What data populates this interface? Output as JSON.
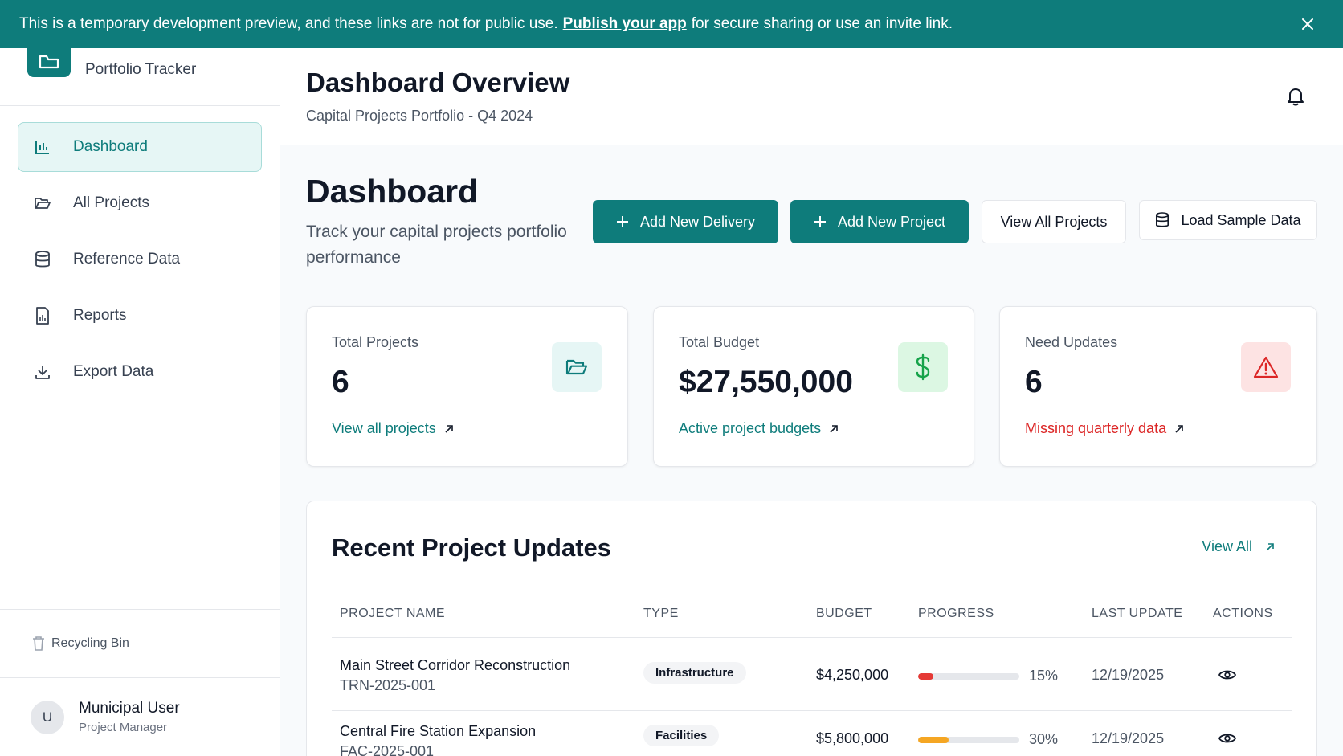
{
  "banner": {
    "text_before": "This is a temporary development preview, and these links are not for public use.",
    "link": "Publish your app",
    "text_after": "for secure sharing or use an invite link."
  },
  "sidebar": {
    "brand": "Portfolio Tracker",
    "items": [
      {
        "label": "Dashboard",
        "icon": "bar-chart-icon",
        "active": true
      },
      {
        "label": "All Projects",
        "icon": "folder-icon"
      },
      {
        "label": "Reference Data",
        "icon": "database-icon"
      },
      {
        "label": "Reports",
        "icon": "report-icon"
      },
      {
        "label": "Export Data",
        "icon": "download-icon"
      }
    ],
    "recycle_label": "Recycling Bin",
    "user": {
      "initial": "U",
      "name": "Municipal User",
      "role": "Project Manager"
    }
  },
  "header": {
    "title": "Dashboard Overview",
    "subtitle": "Capital Projects Portfolio - Q4 2024"
  },
  "main": {
    "title": "Dashboard",
    "description": "Track your capital projects portfolio performance",
    "buttons": {
      "add_delivery": "Add New Delivery",
      "add_project": "Add New Project",
      "view_all": "View All Projects",
      "load_sample": "Load Sample Data"
    },
    "cards": [
      {
        "label": "Total Projects",
        "value": "6",
        "link": "View all projects",
        "accent": "#0e7c7b"
      },
      {
        "label": "Total Budget",
        "value": "$27,550,000",
        "link": "Active project budgets",
        "accent": "#0e7c7b"
      },
      {
        "label": "Need Updates",
        "value": "6",
        "link": "Missing quarterly data",
        "accent": "#dc2626"
      }
    ]
  },
  "updates": {
    "title": "Recent Project Updates",
    "view_all": "View All",
    "columns": [
      "PROJECT NAME",
      "TYPE",
      "BUDGET",
      "PROGRESS",
      "LAST UPDATE",
      "ACTIONS"
    ],
    "rows": [
      {
        "name": "Main Street Corridor Reconstruction",
        "code": "TRN-2025-001",
        "type": "Infrastructure",
        "budget": "$4,250,000",
        "progress": 15,
        "progress_label": "15%",
        "progress_color": "#e53935",
        "date": "12/19/2025"
      },
      {
        "name": "Central Fire Station Expansion",
        "code": "FAC-2025-001",
        "type": "Facilities",
        "budget": "$5,800,000",
        "progress": 30,
        "progress_label": "30%",
        "progress_color": "#f5a623",
        "date": "12/19/2025"
      }
    ]
  }
}
